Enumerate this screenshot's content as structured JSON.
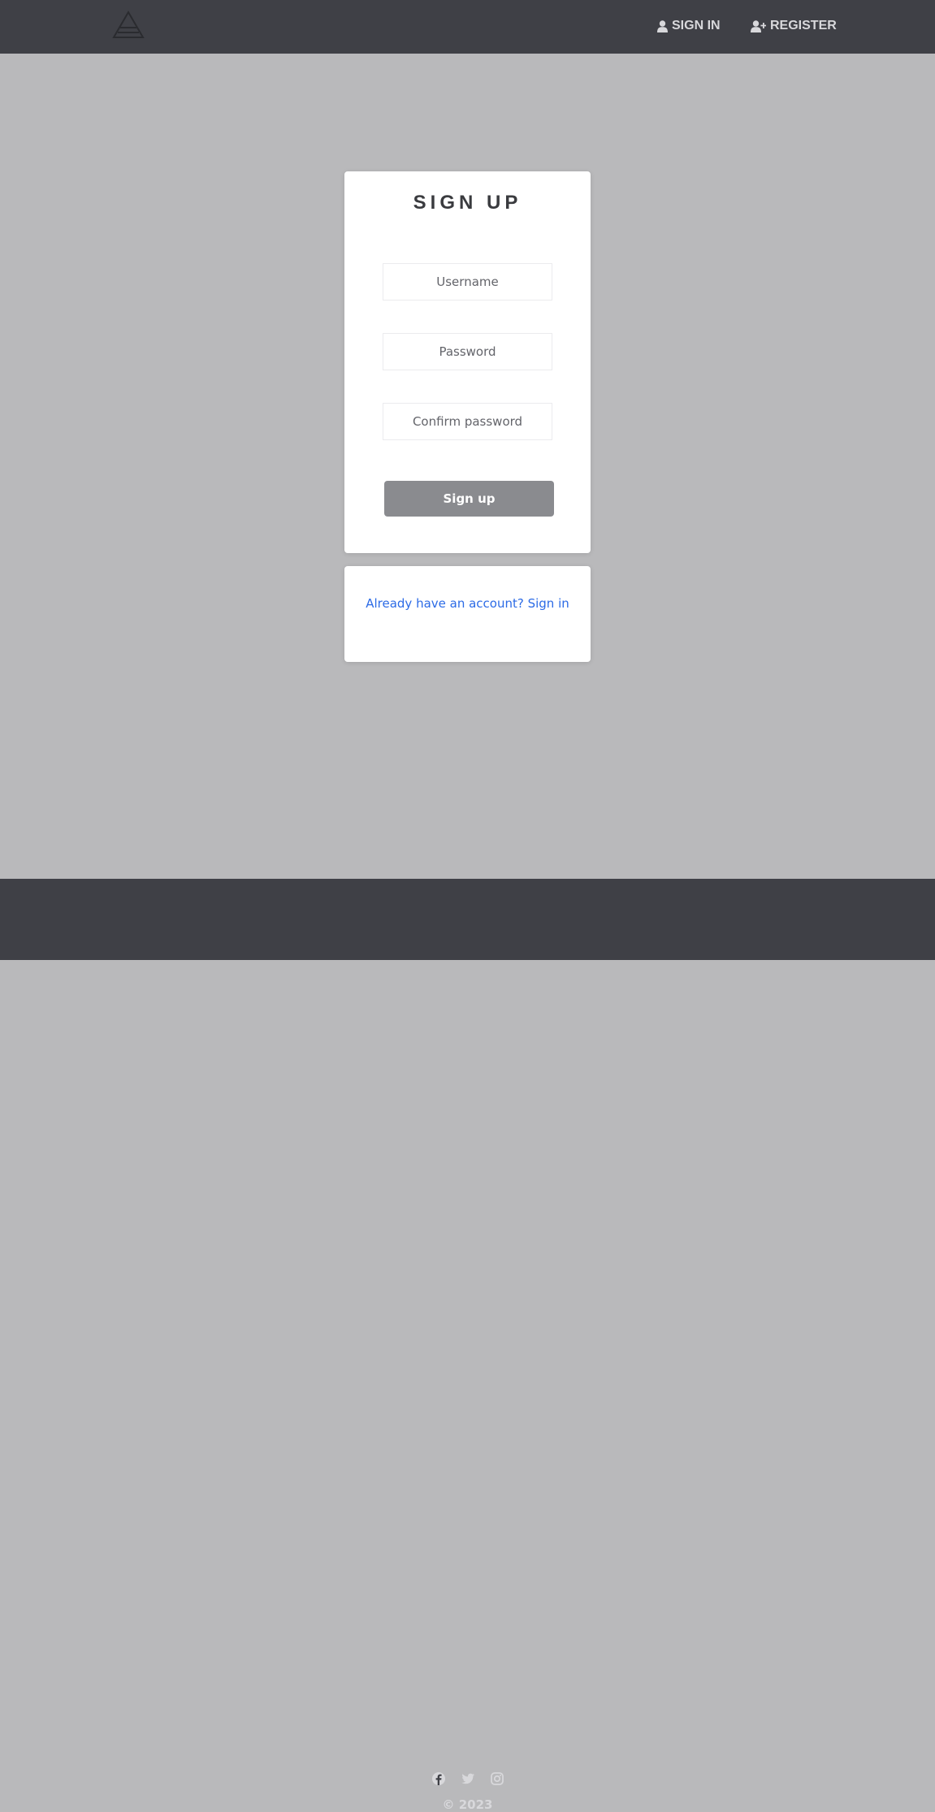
{
  "navbar": {
    "logo_icon": "triangle-logo-icon",
    "links": [
      {
        "label": "SIGN IN",
        "icon": "user-icon"
      },
      {
        "label": "REGISTER",
        "icon": "user-plus-icon"
      }
    ]
  },
  "form": {
    "title": "SIGN UP",
    "username_placeholder": "Username",
    "password_placeholder": "Password",
    "confirm_placeholder": "Confirm password",
    "submit_label": "Sign up"
  },
  "alt": {
    "signin_link": "Already have an account? Sign in"
  },
  "footer": {
    "social": [
      "facebook-icon",
      "twitter-icon",
      "instagram-icon"
    ],
    "copyright": "© 2023"
  },
  "colors": {
    "header_bg": "#3f4046",
    "page_bg": "#b9b9bb",
    "button_bg": "#8a8b8f",
    "link": "#2c6be6"
  }
}
